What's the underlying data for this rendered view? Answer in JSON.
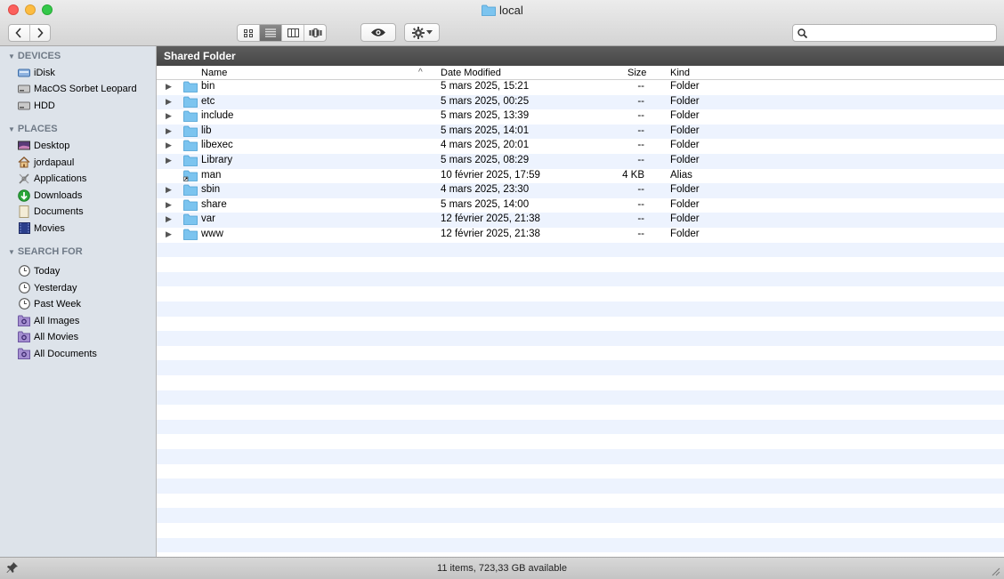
{
  "window": {
    "title": "local"
  },
  "toolbar": {
    "back_label": "‹",
    "forward_label": "›",
    "views": [
      "icon-view",
      "list-view",
      "column-view",
      "cover-flow-view"
    ],
    "active_view": "list-view",
    "search_placeholder": ""
  },
  "sidebar": {
    "sections": [
      {
        "title": "DEVICES",
        "items": [
          {
            "label": "iDisk",
            "icon": "idisk-icon"
          },
          {
            "label": "MacOS Sorbet Leopard",
            "icon": "harddrive-icon"
          },
          {
            "label": "HDD",
            "icon": "harddrive-icon"
          }
        ]
      },
      {
        "title": "PLACES",
        "items": [
          {
            "label": "Desktop",
            "icon": "desktop-icon"
          },
          {
            "label": "jordapaul",
            "icon": "home-icon"
          },
          {
            "label": "Applications",
            "icon": "applications-icon"
          },
          {
            "label": "Downloads",
            "icon": "downloads-icon"
          },
          {
            "label": "Documents",
            "icon": "documents-icon"
          },
          {
            "label": "Movies",
            "icon": "movies-icon"
          }
        ]
      },
      {
        "title": "SEARCH FOR",
        "items": [
          {
            "label": "Today",
            "icon": "clock-icon"
          },
          {
            "label": "Yesterday",
            "icon": "clock-icon"
          },
          {
            "label": "Past Week",
            "icon": "clock-icon"
          },
          {
            "label": "All Images",
            "icon": "smart-folder-icon"
          },
          {
            "label": "All Movies",
            "icon": "smart-folder-icon"
          },
          {
            "label": "All Documents",
            "icon": "smart-folder-icon"
          }
        ]
      }
    ]
  },
  "content": {
    "path_title": "Shared Folder",
    "columns": {
      "name": "Name",
      "sort_indicator": "^",
      "date": "Date Modified",
      "size": "Size",
      "kind": "Kind"
    },
    "files": [
      {
        "name": "bin",
        "date": "5 mars 2025, 15:21",
        "size": "--",
        "kind": "Folder",
        "type": "folder"
      },
      {
        "name": "etc",
        "date": "5 mars 2025, 00:25",
        "size": "--",
        "kind": "Folder",
        "type": "folder"
      },
      {
        "name": "include",
        "date": "5 mars 2025, 13:39",
        "size": "--",
        "kind": "Folder",
        "type": "folder"
      },
      {
        "name": "lib",
        "date": "5 mars 2025, 14:01",
        "size": "--",
        "kind": "Folder",
        "type": "folder"
      },
      {
        "name": "libexec",
        "date": "4 mars 2025, 20:01",
        "size": "--",
        "kind": "Folder",
        "type": "folder"
      },
      {
        "name": "Library",
        "date": "5 mars 2025, 08:29",
        "size": "--",
        "kind": "Folder",
        "type": "folder"
      },
      {
        "name": "man",
        "date": "10 février 2025, 17:59",
        "size": "4 KB",
        "kind": "Alias",
        "type": "alias"
      },
      {
        "name": "sbin",
        "date": "4 mars 2025, 23:30",
        "size": "--",
        "kind": "Folder",
        "type": "folder"
      },
      {
        "name": "share",
        "date": "5 mars 2025, 14:00",
        "size": "--",
        "kind": "Folder",
        "type": "folder"
      },
      {
        "name": "var",
        "date": "12 février 2025, 21:38",
        "size": "--",
        "kind": "Folder",
        "type": "folder"
      },
      {
        "name": "www",
        "date": "12 février 2025, 21:38",
        "size": "--",
        "kind": "Folder",
        "type": "folder"
      }
    ]
  },
  "statusbar": {
    "text": "11 items, 723,33 GB available"
  },
  "colors": {
    "sidebar_bg": "#dde3ea",
    "row_stripe": "#edf3fe",
    "folder_blue": "#7cc4ef",
    "path_header": "#505050"
  }
}
